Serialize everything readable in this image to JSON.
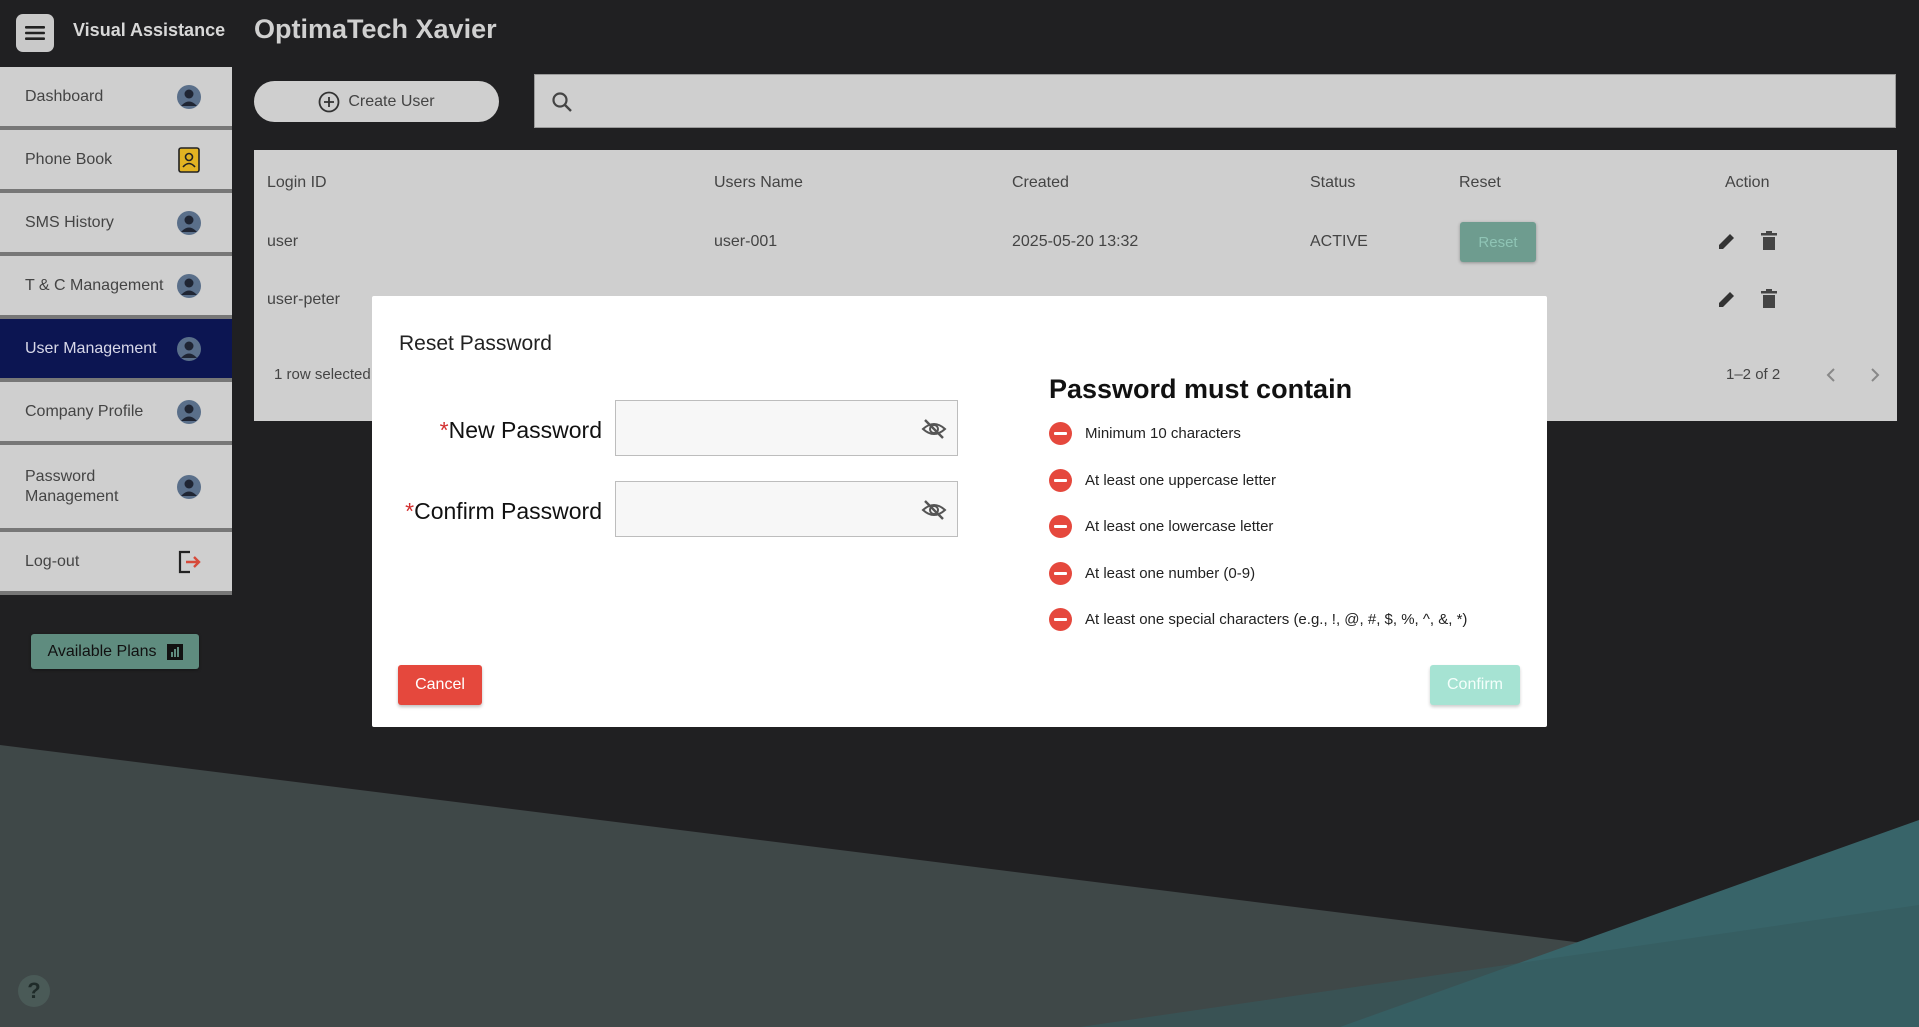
{
  "app": {
    "name": "Visual Assistance",
    "page_title": "OptimaTech Xavier"
  },
  "sidebar": {
    "items": [
      {
        "label": "Dashboard",
        "icon": "avatar-icon"
      },
      {
        "label": "Phone Book",
        "icon": "contact-book-icon"
      },
      {
        "label": "SMS History",
        "icon": "avatar-icon"
      },
      {
        "label": "T & C Management",
        "icon": "avatar-icon"
      },
      {
        "label": "User Management",
        "icon": "avatar-icon",
        "active": true
      },
      {
        "label": "Company Profile",
        "icon": "avatar-icon"
      },
      {
        "label": "Password Management",
        "icon": "avatar-icon"
      },
      {
        "label": "Log-out",
        "icon": "logout-icon"
      }
    ],
    "plans_label": "Available Plans"
  },
  "toolbar": {
    "create_label": "Create User",
    "search_placeholder": ""
  },
  "table": {
    "headers": [
      "Login ID",
      "Users Name",
      "Created",
      "Status",
      "Reset",
      "Action"
    ],
    "rows": [
      {
        "login_id": "user",
        "users_name": "user-001",
        "created": "2025-05-20 13:32",
        "status": "ACTIVE",
        "reset_label": "Reset"
      },
      {
        "login_id": "user-peter",
        "users_name": "",
        "created": "",
        "status": "",
        "reset_label": ""
      }
    ],
    "selection_text": "1 row selected",
    "pagination_text": "1–2 of 2"
  },
  "modal": {
    "title": "Reset Password",
    "new_password_label": "New Password",
    "confirm_password_label": "Confirm Password",
    "required_mark": "*",
    "rules_title": "Password must contain",
    "rules": [
      "Minimum 10 characters",
      "At least one uppercase letter",
      "At least one lowercase letter",
      "At least one number (0-9)",
      "At least one special characters (e.g., !, @, #, $, %, ^, &, *)"
    ],
    "cancel_label": "Cancel",
    "confirm_label": "Confirm"
  },
  "help_label": "?",
  "colors": {
    "background": "#202022",
    "active_nav": "#0c1552",
    "danger": "#e5483d",
    "confirm_disabled": "#a6e3d3",
    "reset_button": "#6e9c8f",
    "bg_shape_teal": "#3c6669"
  }
}
